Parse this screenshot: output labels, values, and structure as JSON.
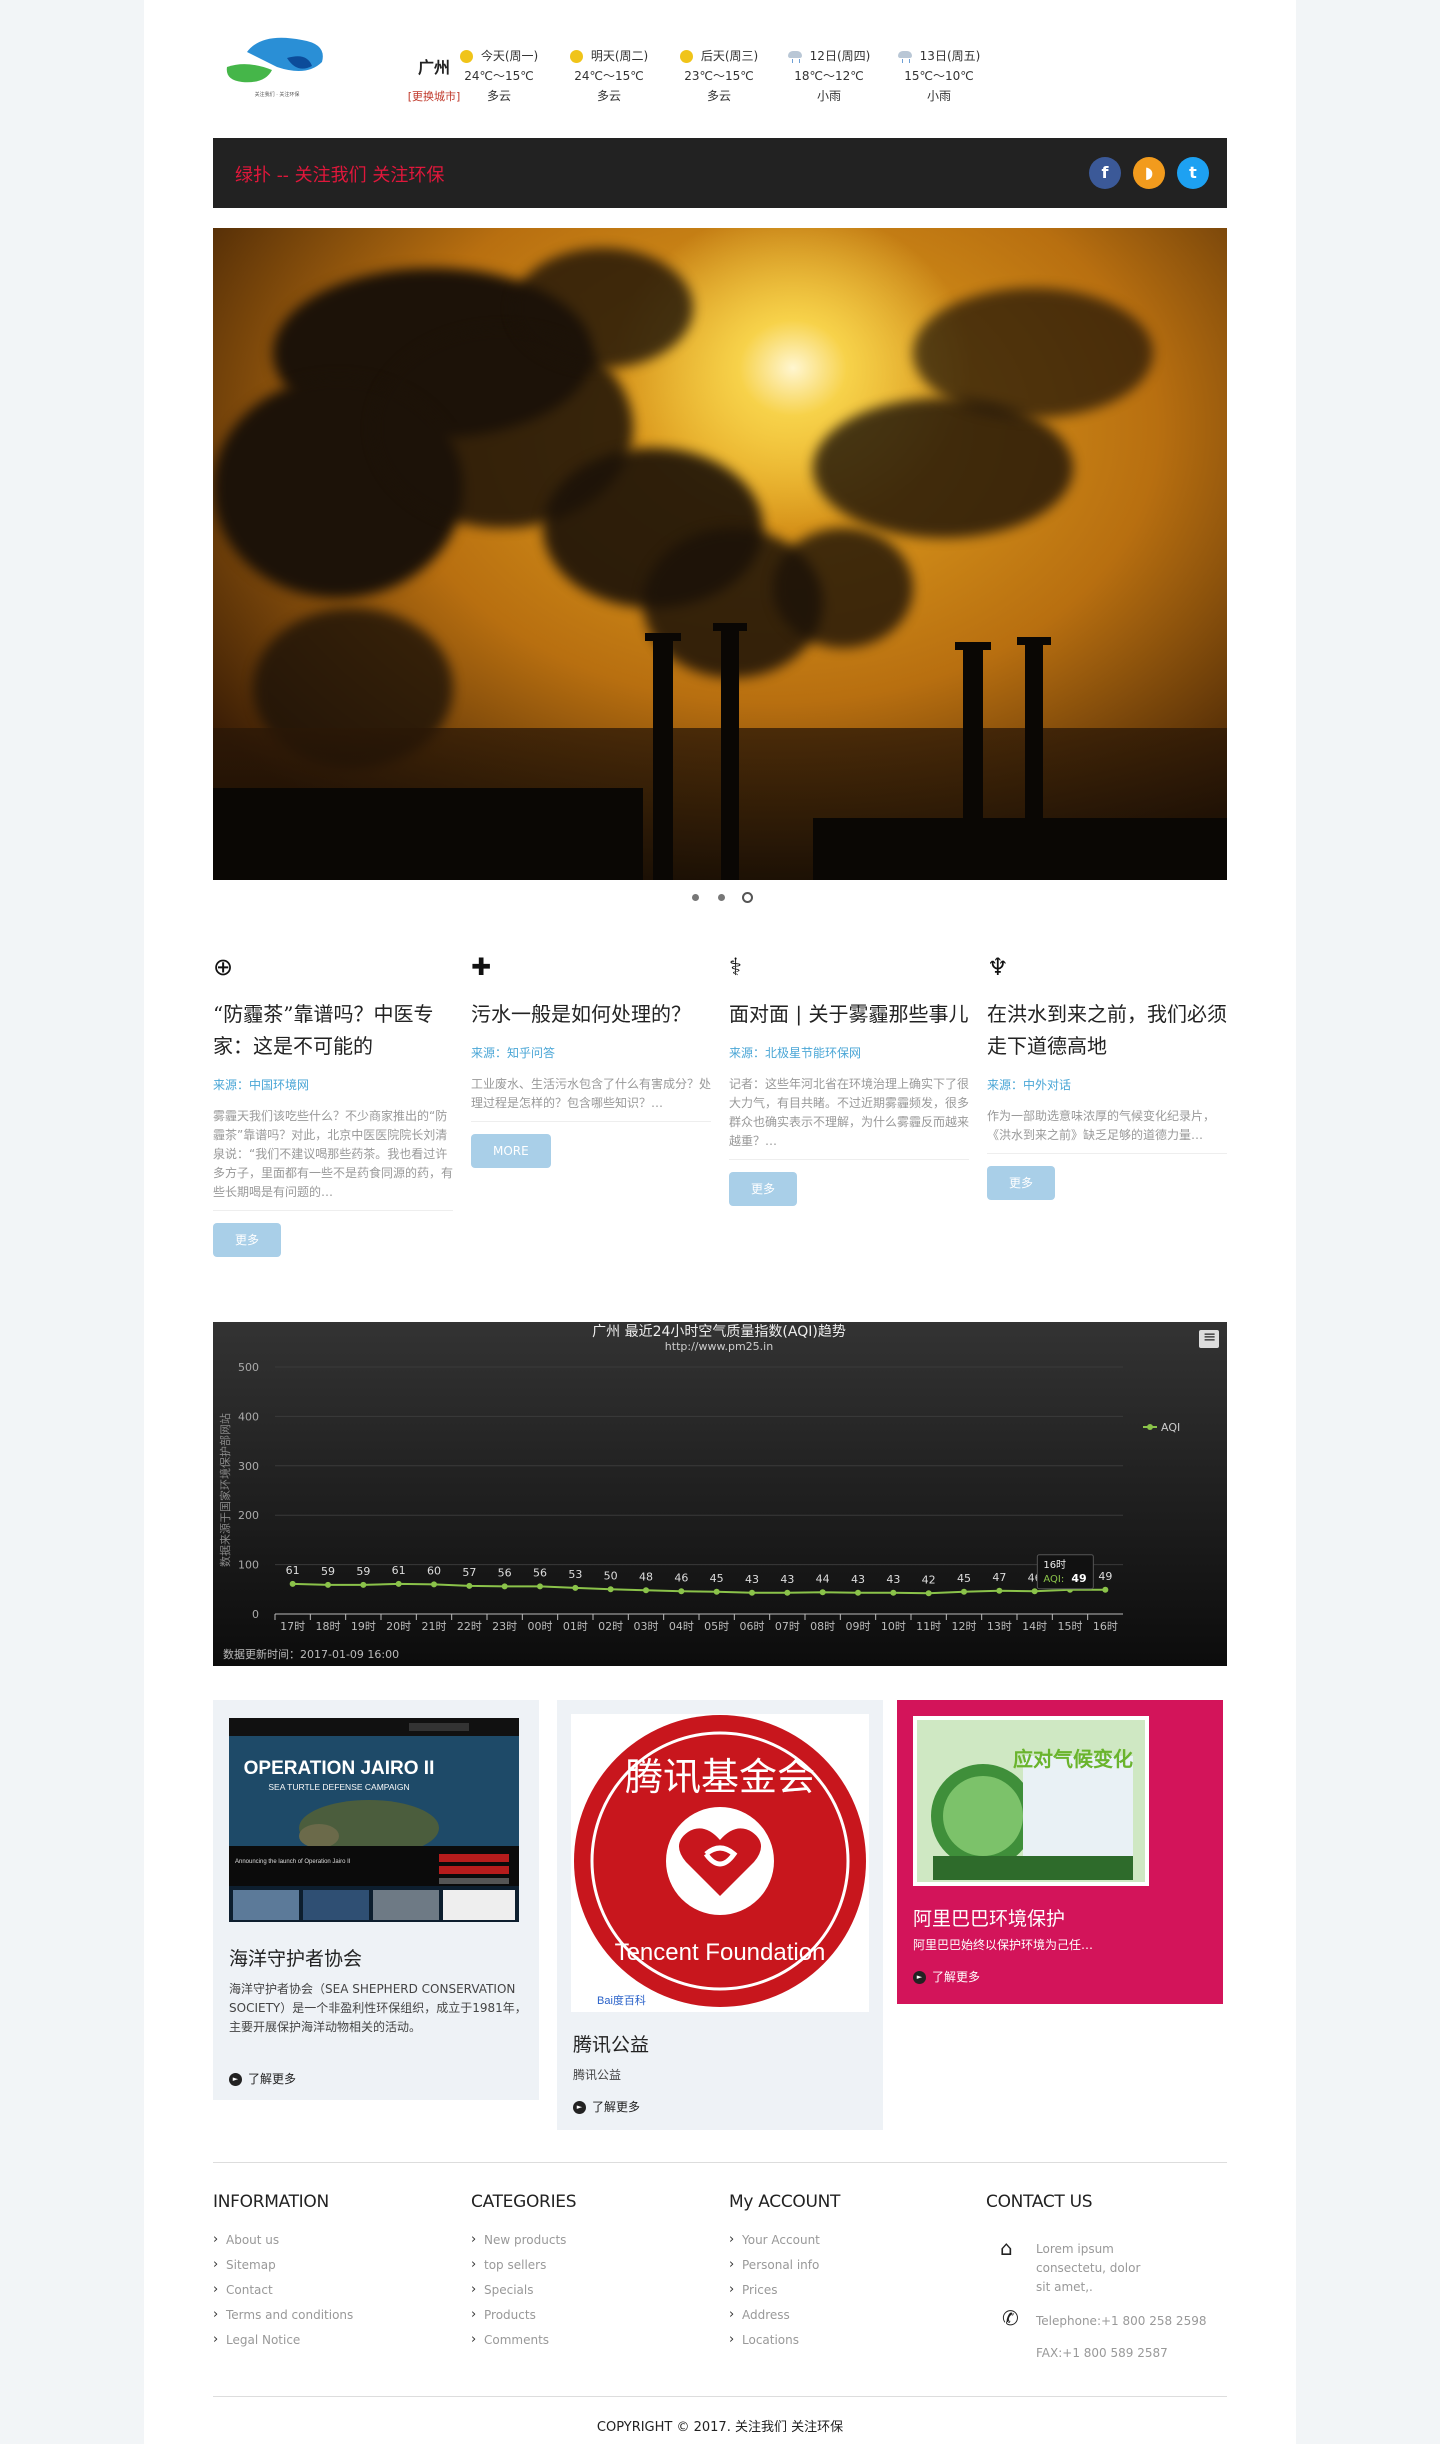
{
  "header": {
    "logo_alt": "logo",
    "city": "广州",
    "change_city": "[更换城市]",
    "forecast": [
      {
        "day": "今天(周一)",
        "temp": "24℃～15℃",
        "cond": "多云",
        "icon": "sun-icon"
      },
      {
        "day": "明天(周二)",
        "temp": "24℃～15℃",
        "cond": "多云",
        "icon": "sun-icon"
      },
      {
        "day": "后天(周三)",
        "temp": "23℃～15℃",
        "cond": "多云",
        "icon": "sun-icon"
      },
      {
        "day": "12日(周四)",
        "temp": "18℃～12℃",
        "cond": "小雨",
        "icon": "rain-icon"
      },
      {
        "day": "13日(周五)",
        "temp": "15℃～10℃",
        "cond": "小雨",
        "icon": "rain-icon"
      }
    ]
  },
  "banner": {
    "title": "绿扑 -- 关注我们 关注环保",
    "social": [
      {
        "name": "facebook-icon",
        "glyph": "f",
        "color": "#3b5998"
      },
      {
        "name": "rss-icon",
        "glyph": "◗",
        "color": "#f29b1d"
      },
      {
        "name": "twitter-icon",
        "glyph": "t",
        "color": "#1da1f2"
      }
    ]
  },
  "articles": [
    {
      "icon": "plus-circle-icon",
      "glyph": "⊕",
      "title": "“防霾茶”靠谱吗？中医专家：这是不可能的",
      "source": "来源：中国环境网",
      "summary": "雾霾天我们该吃些什么？不少商家推出的“防霾茶”靠谱吗？对此，北京中医医院院长刘清泉说：“我们不建议喝那些药茶。我也看过许多方子，里面都有一些不是药食同源的药，有些长期喝是有问题的…",
      "button": "更多"
    },
    {
      "icon": "medkit-icon",
      "glyph": "✚",
      "title": "污水一般是如何处理的？",
      "source": "来源：知乎问答",
      "summary": "工业废水、生活污水包含了什么有害成分？处理过程是怎样的？包含哪些知识？…",
      "button": "MORE"
    },
    {
      "icon": "syringe-icon",
      "glyph": "⚕",
      "title": "面对面 | 关于雾霾那些事儿",
      "source": "来源：北极星节能环保网",
      "summary": "记者：这些年河北省在环境治理上确实下了很大力气，有目共睹。不过近期雾霾频发，很多群众也确实表示不理解，为什么雾霾反而越来越重？…",
      "button": "更多"
    },
    {
      "icon": "beaker-icon",
      "glyph": "♆",
      "title": "在洪水到来之前，我们必须走下道德高地",
      "source": "来源：中外对话",
      "summary": "作为一部助选意味浓厚的气候变化纪录片，《洪水到来之前》缺乏足够的道德力量…",
      "button": "更多"
    }
  ],
  "chart_data": {
    "type": "line",
    "title": "广州 最近24小时空气质量指数(AQI)趋势",
    "subtitle": "http://www.pm25.in",
    "ylabel": "数据来源于国家环境保护部网站",
    "ylim": [
      0,
      500
    ],
    "yticks": [
      0,
      100,
      200,
      300,
      400,
      500
    ],
    "grid": true,
    "legend_position": "right",
    "series": [
      {
        "name": "AQI",
        "color": "#8bc34a",
        "values": [
          61,
          59,
          59,
          61,
          60,
          57,
          56,
          56,
          53,
          50,
          48,
          46,
          45,
          43,
          43,
          44,
          43,
          43,
          42,
          45,
          47,
          46,
          49,
          49
        ]
      }
    ],
    "categories": [
      "17时",
      "18时",
      "19时",
      "20时",
      "21时",
      "22时",
      "23时",
      "00时",
      "01时",
      "02时",
      "03时",
      "04时",
      "05时",
      "06时",
      "07时",
      "08时",
      "09时",
      "10时",
      "11时",
      "12时",
      "13时",
      "14时",
      "15时",
      "16时"
    ],
    "tooltip": {
      "label": "16时",
      "series": "AQI:",
      "value": "49"
    },
    "footnote": "数据更新时间：2017-01-09 16:00"
  },
  "cards": [
    {
      "title": "海洋守护者协会",
      "desc": "海洋守护者协会（SEA SHEPHERD CONSERVATION SOCIETY）是一个非盈利性环保组织，成立于1981年，主要开展保护海洋动物相关的活动。",
      "more": "了解更多",
      "img_title": "OPERATION JAIRO II",
      "img_sub": "SEA TURTLE DEFENSE CAMPAIGN",
      "img_caption": "Announcing the launch of Operation Jairo II"
    },
    {
      "title": "腾讯公益",
      "desc": "腾讯公益",
      "more": "了解更多",
      "img_cn": "腾讯基金会",
      "img_en": "Tencent Foundation",
      "img_mark": "Bai度百科"
    },
    {
      "title": "阿里巴巴环境保护",
      "desc": "阿里巴巴始终以保护环境为己任…",
      "more": "了解更多",
      "img_text": "应对气候变化"
    }
  ],
  "footer": {
    "cols": [
      {
        "title": "INFORMATION",
        "items": [
          "About us",
          "Sitemap",
          "Contact",
          "Terms and conditions",
          "Legal Notice"
        ]
      },
      {
        "title": "CATEGORIES",
        "items": [
          "New products",
          "top sellers",
          "Specials",
          "Products",
          "Comments"
        ]
      },
      {
        "title": "My ACCOUNT",
        "items": [
          "Your Account",
          "Personal info",
          "Prices",
          "Address",
          "Locations"
        ]
      }
    ],
    "contact_title": "CONTACT US",
    "address": "Lorem ipsum consectetu, dolor sit amet,.",
    "telephone": "Telephone:+1 800 258 2598",
    "fax": "FAX:+1 800 589 2587",
    "copyright": "COPYRIGHT © 2017. 关注我们 关注环保"
  }
}
